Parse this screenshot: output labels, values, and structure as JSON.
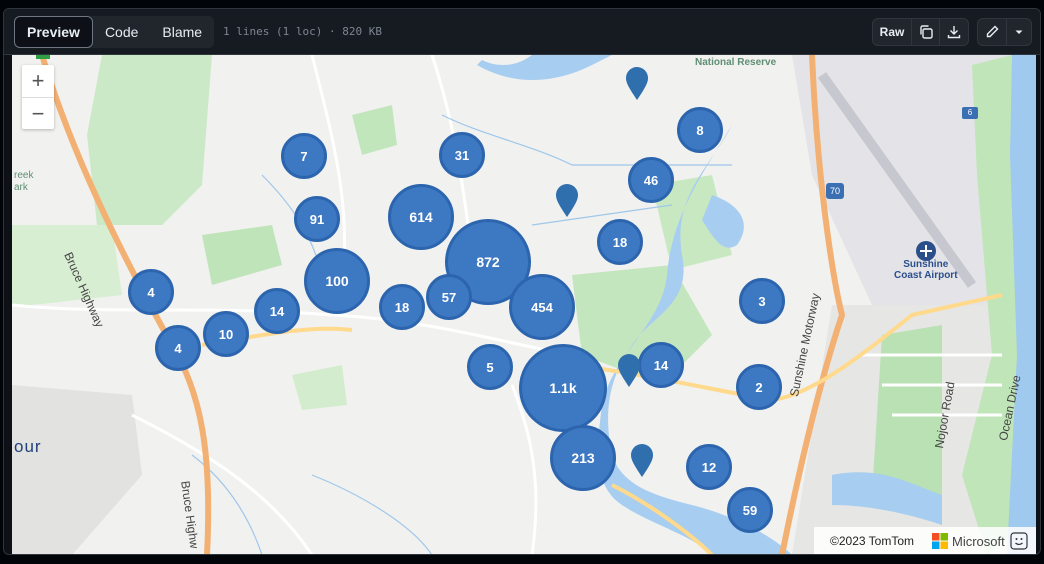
{
  "toolbar": {
    "tabs": [
      {
        "label": "Preview",
        "active": true
      },
      {
        "label": "Code"
      },
      {
        "label": "Blame"
      }
    ],
    "file_meta": "1 lines (1 loc) · 820 KB",
    "raw_label": "Raw"
  },
  "map": {
    "zoom_in": "+",
    "zoom_out": "−",
    "place_labels": {
      "reserve": "National Reserve",
      "airport": "Sunshine\nCoast Airport",
      "bruce_hwy": "Bruce Highway",
      "bruce_hwy_2": "Bruce Highw",
      "sunshine_mwy": "Sunshine Motorway",
      "nojoor_rd": "Nojoor Road",
      "ocean_dr": "Ocean Drive",
      "creek": "reek",
      "park": "ark",
      "town": "our",
      "shield_70": "70",
      "shield_6": "6"
    },
    "clusters": [
      "7",
      "31",
      "8",
      "46",
      "91",
      "614",
      "872",
      "18",
      "4",
      "100",
      "57",
      "454",
      "3",
      "14",
      "18",
      "10",
      "4",
      "5",
      "1.1k",
      "14",
      "2",
      "213",
      "12",
      "59"
    ],
    "attribution": {
      "copyright": "©2023 TomTom",
      "brand": "Microsoft"
    }
  },
  "colors": {
    "cluster_fill": "#3d78c2",
    "pin": "#2f6fad",
    "water": "#a7cdf0",
    "park": "#b8e2b4"
  }
}
